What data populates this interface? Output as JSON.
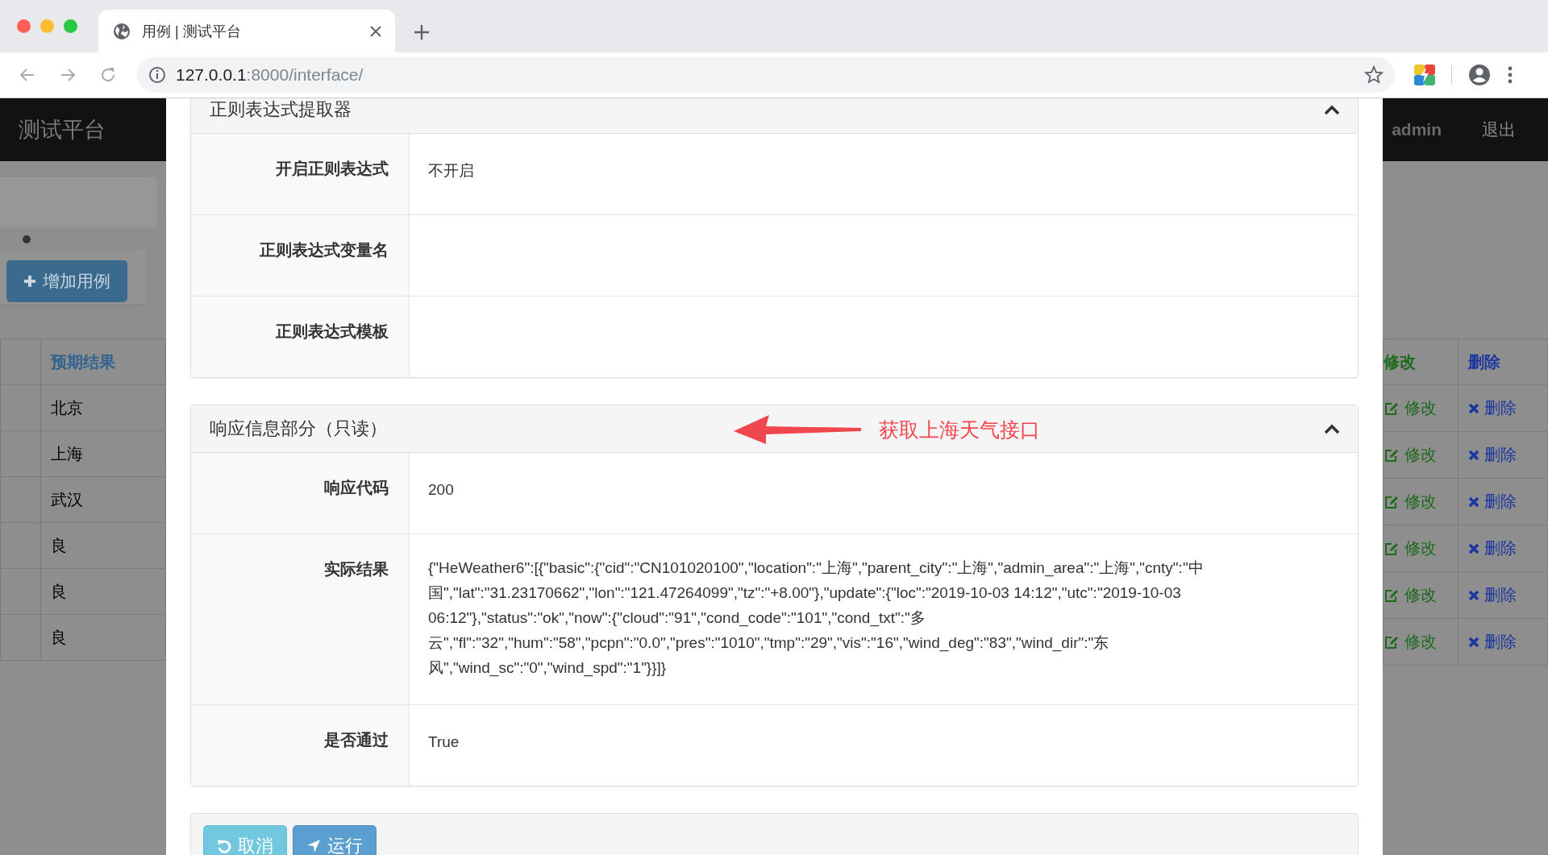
{
  "browser": {
    "tab_title": "用例 | 测试平台",
    "url_host": "127.0.0.1",
    "url_path": ":8000/interface/"
  },
  "navbar": {
    "brand": "测试平台",
    "user": "admin",
    "logout": "退出"
  },
  "sidebar": {
    "add_button": "增加用例"
  },
  "table_left": {
    "column": "预期结果",
    "rows": [
      "北京",
      "上海",
      "武汉",
      "良",
      "良",
      "良"
    ]
  },
  "table_right": {
    "columns": [
      "修改",
      "删除"
    ],
    "rows": [
      {
        "edit": "修改",
        "delete": "删除"
      },
      {
        "edit": "修改",
        "delete": "删除"
      },
      {
        "edit": "修改",
        "delete": "删除"
      },
      {
        "edit": "修改",
        "delete": "删除"
      },
      {
        "edit": "修改",
        "delete": "删除"
      },
      {
        "edit": "修改",
        "delete": "删除"
      }
    ]
  },
  "modal": {
    "sections": [
      {
        "title": "正则表达式提取器",
        "expanded": true,
        "fields": [
          {
            "label": "开启正则表达式",
            "value": "不开启"
          },
          {
            "label": "正则表达式变量名"
          },
          {
            "label": "正则表达式模板"
          }
        ]
      },
      {
        "title": "响应信息部分（只读）",
        "expanded": true,
        "annotation": "获取上海天气接口",
        "fields": [
          {
            "label": "响应代码",
            "value": "200"
          },
          {
            "label": "实际结果",
            "value": "{\"HeWeather6\":[{\"basic\":{\"cid\":\"CN101020100\",\"location\":\"上海\",\"parent_city\":\"上海\",\"admin_area\":\"上海\",\"cnty\":\"中国\",\"lat\":\"31.23170662\",\"lon\":\"121.47264099\",\"tz\":\"+8.00\"},\"update\":{\"loc\":\"2019-10-03 14:12\",\"utc\":\"2019-10-03 06:12\"},\"status\":\"ok\",\"now\":{\"cloud\":\"91\",\"cond_code\":\"101\",\"cond_txt\":\"多云\",\"fl\":\"32\",\"hum\":\"58\",\"pcpn\":\"0.0\",\"pres\":\"1010\",\"tmp\":\"29\",\"vis\":\"16\",\"wind_deg\":\"83\",\"wind_dir\":\"东风\",\"wind_sc\":\"0\",\"wind_spd\":\"1\"}}]}"
          },
          {
            "label": "是否通过",
            "value": "True"
          }
        ]
      }
    ],
    "buttons": [
      {
        "label": "取消",
        "kind": "cancel"
      },
      {
        "label": "运行",
        "kind": "run"
      }
    ]
  }
}
